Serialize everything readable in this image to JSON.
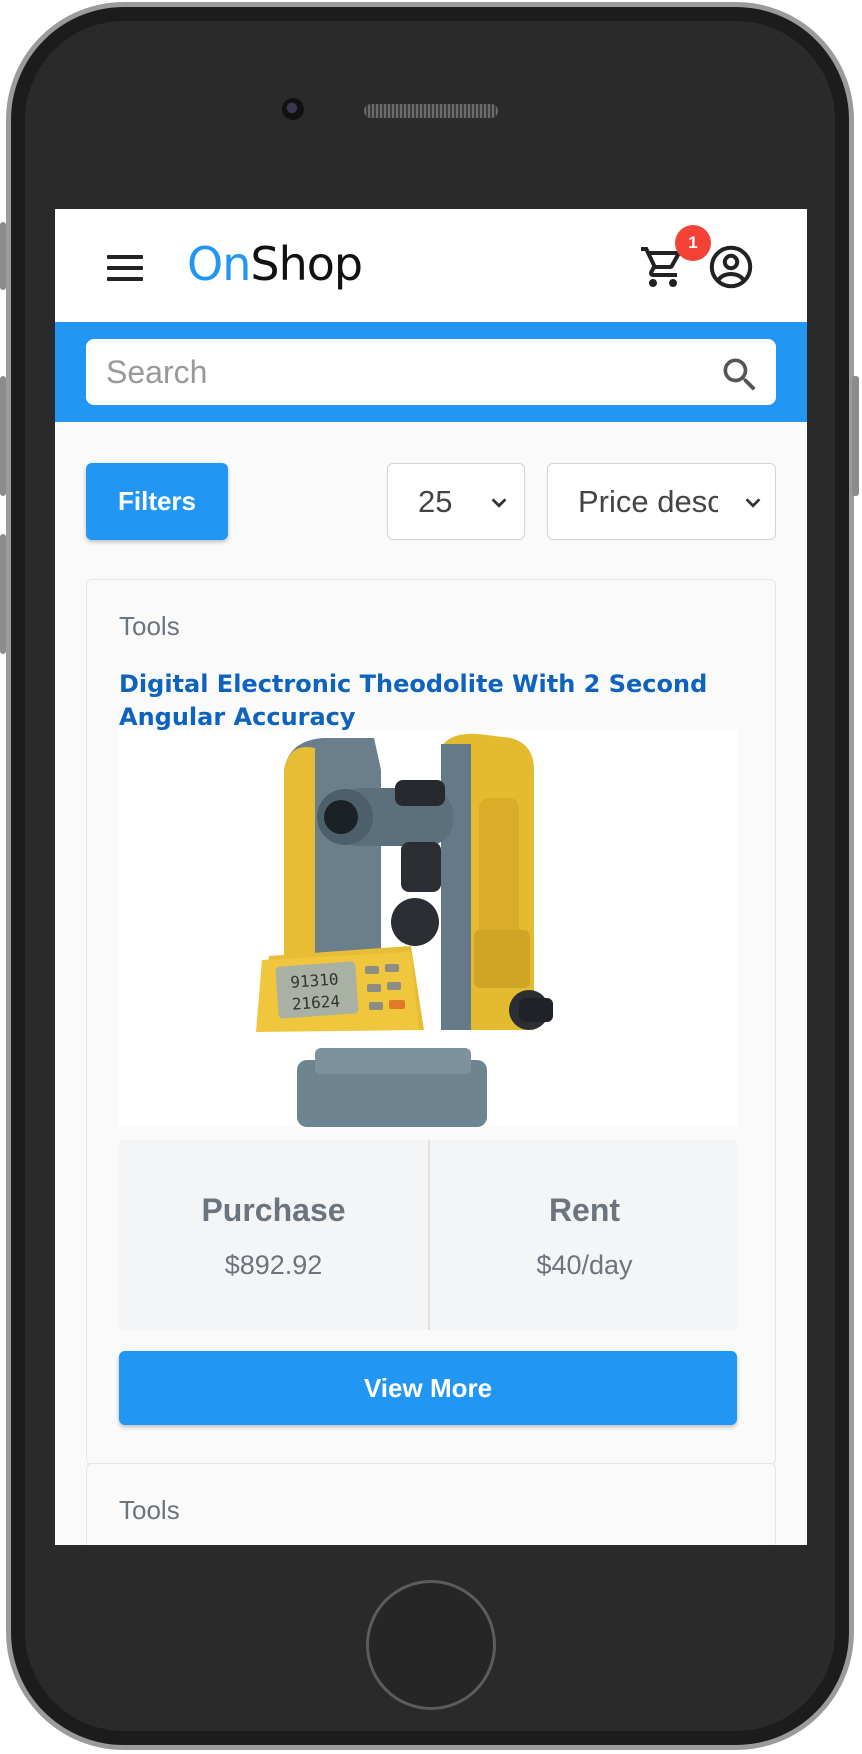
{
  "header": {
    "logo_part1": "On",
    "logo_part2": "Shop",
    "cart_count": "1",
    "icons": [
      "menu-icon",
      "cart-icon",
      "account-circle-icon"
    ]
  },
  "search": {
    "placeholder": "Search",
    "icon": "search-icon"
  },
  "toolbar": {
    "filters_label": "Filters",
    "per_page": "25",
    "sort": "Price desc"
  },
  "products": [
    {
      "category": "Tools",
      "title": "Digital Electronic Theodolite With 2 Second Angular Accuracy",
      "purchase_label": "Purchase",
      "purchase_price": "$892.92",
      "rent_label": "Rent",
      "rent_price": "$40/day",
      "button_label": "View More"
    },
    {
      "category": "Tools"
    }
  ],
  "colors": {
    "primary": "#2196f3",
    "badge": "#f44336",
    "title_link": "#0d63bd",
    "muted_text": "#6c757d"
  }
}
